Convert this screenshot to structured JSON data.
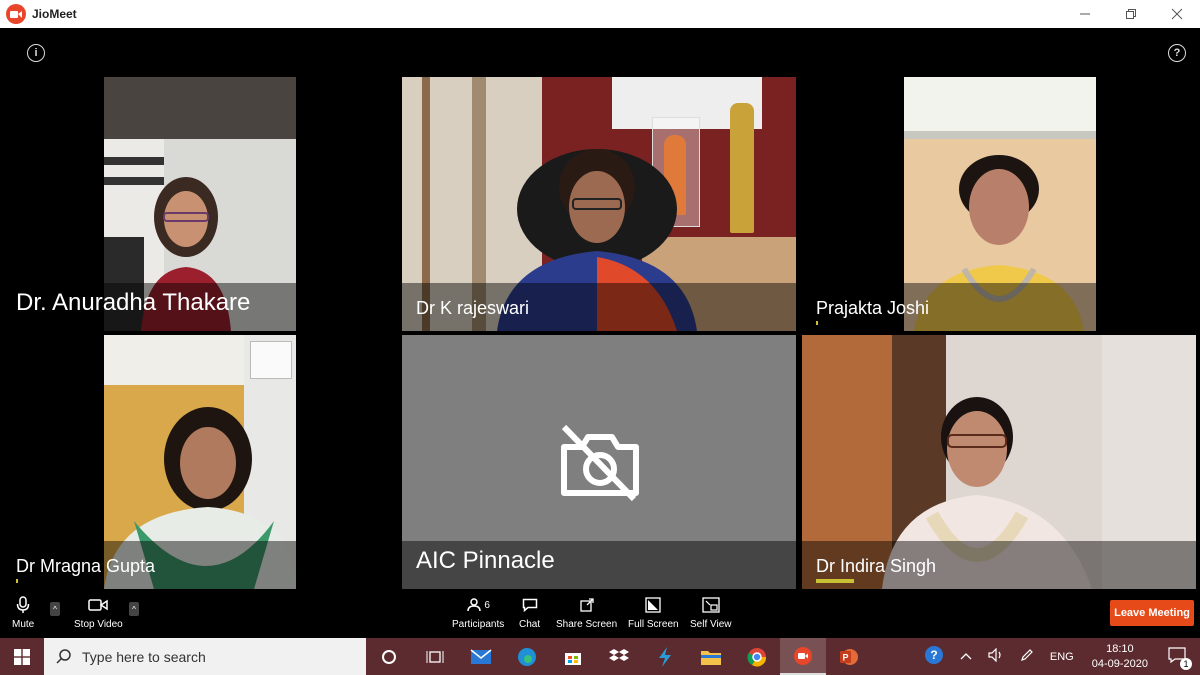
{
  "window": {
    "title": "JioMeet"
  },
  "participants": [
    {
      "name": "Dr. Anuradha Thakare"
    },
    {
      "name": "Dr K rajeswari"
    },
    {
      "name": "Prajakta Joshi"
    },
    {
      "name": "Dr Mragna Gupta"
    },
    {
      "name": "AIC Pinnacle",
      "video_off": true
    },
    {
      "name": "Dr Indira Singh"
    }
  ],
  "controls": {
    "mute": "Mute",
    "stop_video": "Stop Video",
    "participants_label": "Participants",
    "participants_count": "6",
    "chat": "Chat",
    "share_screen": "Share Screen",
    "full_screen": "Full Screen",
    "self_view": "Self View",
    "leave": "Leave Meeting"
  },
  "taskbar": {
    "search_placeholder": "Type here to search",
    "language": "ENG",
    "time": "18:10",
    "date": "04-09-2020",
    "notifications": "1"
  },
  "colors": {
    "leave_button": "#e64a19",
    "brand": "#e8462a",
    "taskbar": "#5b2b2f",
    "video_off_tile": "#7f7f7f"
  }
}
